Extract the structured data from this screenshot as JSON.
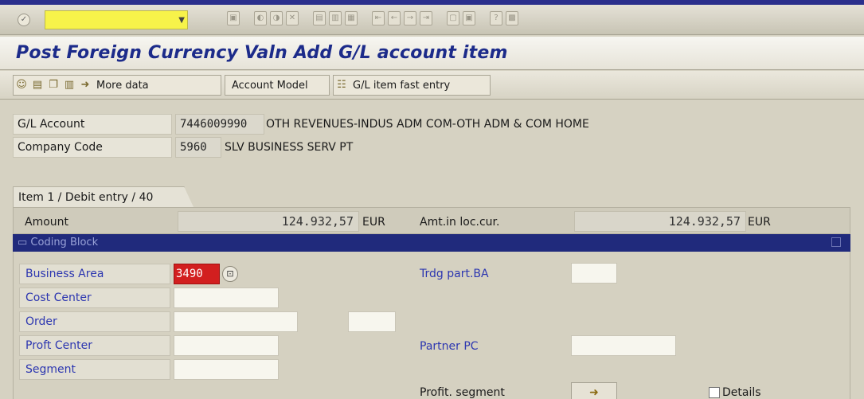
{
  "title": "Post Foreign Currency Valn Add G/L account item",
  "system_toolbar": {
    "ok_icon": "check-icon",
    "command_value": "",
    "icons": [
      "save-icon",
      "back-icon",
      "exit-icon",
      "cancel-icon",
      "print-icon",
      "find-icon",
      "find-next-icon",
      "first-page-icon",
      "prev-page-icon",
      "next-page-icon",
      "last-page-icon",
      "new-session-icon",
      "shortcut-icon",
      "help-icon",
      "layout-icon"
    ]
  },
  "app_toolbar": {
    "more_data": "More data",
    "account_model": "Account Model",
    "fast_entry": "G/L item fast entry"
  },
  "header": {
    "gl_account_label": "G/L Account",
    "gl_account_value": "7446009990",
    "gl_account_desc": "OTH REVENUES-INDUS ADM COM-OTH ADM & COM HOME",
    "company_code_label": "Company Code",
    "company_code_value": "5960",
    "company_code_desc": "SLV BUSINESS SERV PT"
  },
  "item": {
    "tab_label": "Item 1 / Debit entry / 40",
    "amount_label": "Amount",
    "amount_value": "124.932,57",
    "amount_currency": "EUR",
    "loc_label": "Amt.in loc.cur.",
    "loc_value": "124.932,57",
    "loc_currency": "EUR"
  },
  "coding_block": {
    "title": "Coding Block",
    "business_area_label": "Business Area",
    "business_area_value": "3490",
    "cost_center_label": "Cost Center",
    "order_label": "Order",
    "profit_center_label": "Proft Center",
    "segment_label": "Segment",
    "trdg_part_label": "Trdg part.BA",
    "partner_pc_label": "Partner PC",
    "profit_segment_label": "Profit. segment",
    "details_label": "Details",
    "error_color": "#d21f1f"
  }
}
